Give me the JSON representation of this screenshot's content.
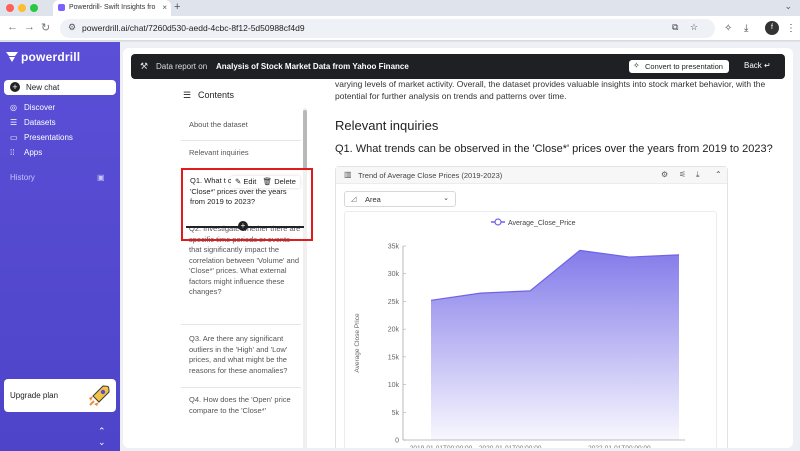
{
  "browser": {
    "tab_title": "Powerdrill- Swift Insights fro",
    "url": "powerdrill.ai/chat/7260d530-aedd-4cbc-8f12-5d50988cf4d9"
  },
  "sidebar": {
    "brand": "powerdrill",
    "new_chat": "New chat",
    "items": [
      {
        "label": "Discover",
        "icon": "compass-icon"
      },
      {
        "label": "Datasets",
        "icon": "database-icon"
      },
      {
        "label": "Presentations",
        "icon": "presentation-icon"
      },
      {
        "label": "Apps",
        "icon": "grid-icon"
      }
    ],
    "history_label": "History",
    "upgrade_label": "Upgrade plan"
  },
  "report_bar": {
    "prefix": "Data report on",
    "title": "Analysis of Stock Market Data from Yahoo Finance",
    "convert_label": "Convert to presentation",
    "back_label": "Back"
  },
  "contents": {
    "heading": "Contents",
    "items": [
      "About the dataset",
      "Relevant inquiries",
      "Q2. Investigate whether there are specific time periods or events that significantly impact the correlation between 'Volume' and 'Close*' prices. What external factors might influence these changes?",
      "Q3. Are there any significant outliers in the 'High' and 'Low' prices, and what might be the reasons for these anomalies?",
      "Q4. How does the 'Open' price compare to the 'Close*'"
    ],
    "highlighted_item": "Q1. What t observed in the 'Close*' prices over the years from 2019 to 2023?",
    "edit_label": "Edit",
    "delete_label": "Delete"
  },
  "report": {
    "intro_text": "varying levels of market activity. Overall, the dataset provides valuable insights into stock market behavior, with the potential for further analysis on trends and patterns over time.",
    "section_heading": "Relevant inquiries",
    "question_heading": "Q1. What trends can be observed in the 'Close*' prices over the years from 2019 to 2023?"
  },
  "chart_card": {
    "title": "Trend of Average Close Prices (2019-2023)",
    "chart_type_label": "Area"
  },
  "chart_data": {
    "type": "area",
    "title": "Trend of Average Close Prices (2019-2023)",
    "ylabel": "Average Close Price",
    "xlabel": "",
    "legend": "Average_Close_Price",
    "legend_position": "top",
    "color": "#6e64e6",
    "ylim": [
      0,
      35000
    ],
    "yticks": [
      "0",
      "5k",
      "10k",
      "15k",
      "20k",
      "25k",
      "30k",
      "35k"
    ],
    "xtick_labels": [
      "2019-01-01T00:00:00",
      "2020-01-01T00:00:00",
      "2022-01-01T00:00:00"
    ],
    "series": [
      {
        "name": "Average_Close_Price",
        "values": [
          25200,
          26500,
          26900,
          34200,
          33000,
          33400
        ]
      }
    ]
  },
  "colors": {
    "sidebar": "#5a4fd6",
    "highlight_box": "#e01b1b",
    "topbar": "#1f2024"
  }
}
